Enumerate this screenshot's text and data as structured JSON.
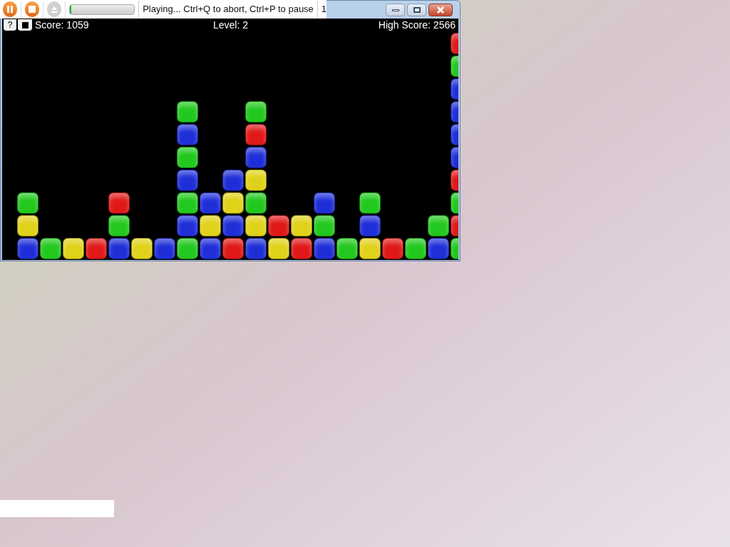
{
  "toolbar": {
    "pause": {
      "disabled": false
    },
    "stop": {
      "disabled": false
    },
    "eject": {
      "disabled": true
    },
    "progress": {
      "level": 0.02
    },
    "status": "Playing... Ctrl+Q to abort, Ctrl+P to pause",
    "counter": "1"
  },
  "window": {
    "buttons": [
      {
        "kind": "minimize"
      },
      {
        "kind": "maximize"
      },
      {
        "kind": "close"
      }
    ]
  },
  "hud": {
    "help": "?",
    "score": "Score: 1059",
    "level": "Level: 2",
    "high_score": "High Score: 2566"
  },
  "board": {
    "columns": [
      {
        "blocks": [
          {
            "color": "#1f2fd8"
          },
          {
            "color": "#e0d21a"
          },
          {
            "color": "#22c81e"
          }
        ]
      },
      {
        "blocks": [
          {
            "color": "#22c81e"
          }
        ]
      },
      {
        "blocks": [
          {
            "color": "#e0d21a"
          }
        ]
      },
      {
        "blocks": [
          {
            "color": "#e01818"
          }
        ]
      },
      {
        "blocks": [
          {
            "color": "#1f2fd8"
          },
          {
            "color": "#22c81e"
          },
          {
            "color": "#e01818"
          }
        ]
      },
      {
        "blocks": [
          {
            "color": "#e0d21a"
          }
        ]
      },
      {
        "blocks": [
          {
            "color": "#1f2fd8"
          }
        ]
      },
      {
        "blocks": [
          {
            "color": "#22c81e"
          },
          {
            "color": "#1f2fd8"
          },
          {
            "color": "#22c81e"
          },
          {
            "color": "#1f2fd8"
          },
          {
            "color": "#22c81e"
          },
          {
            "color": "#1f2fd8"
          },
          {
            "color": "#22c81e"
          }
        ]
      },
      {
        "blocks": [
          {
            "color": "#1f2fd8"
          },
          {
            "color": "#e0d21a"
          },
          {
            "color": "#1f2fd8"
          }
        ]
      },
      {
        "blocks": [
          {
            "color": "#e01818"
          },
          {
            "color": "#1f2fd8"
          },
          {
            "color": "#e0d21a"
          },
          {
            "color": "#1f2fd8"
          }
        ]
      },
      {
        "blocks": [
          {
            "color": "#1f2fd8"
          },
          {
            "color": "#e0d21a"
          },
          {
            "color": "#22c81e"
          },
          {
            "color": "#e0d21a"
          },
          {
            "color": "#1f2fd8"
          },
          {
            "color": "#e01818"
          },
          {
            "color": "#22c81e"
          }
        ]
      },
      {
        "blocks": [
          {
            "color": "#e0d21a"
          },
          {
            "color": "#e01818"
          }
        ]
      },
      {
        "blocks": [
          {
            "color": "#e01818"
          },
          {
            "color": "#e0d21a"
          }
        ]
      },
      {
        "blocks": [
          {
            "color": "#1f2fd8"
          },
          {
            "color": "#22c81e"
          },
          {
            "color": "#1f2fd8"
          }
        ]
      },
      {
        "blocks": [
          {
            "color": "#22c81e"
          }
        ]
      },
      {
        "blocks": [
          {
            "color": "#e0d21a"
          },
          {
            "color": "#1f2fd8"
          },
          {
            "color": "#22c81e"
          }
        ]
      },
      {
        "blocks": [
          {
            "color": "#e01818"
          }
        ]
      },
      {
        "blocks": [
          {
            "color": "#22c81e"
          }
        ]
      },
      {
        "blocks": [
          {
            "color": "#1f2fd8"
          },
          {
            "color": "#22c81e"
          }
        ]
      },
      {
        "blocks": [
          {
            "color": "#22c81e"
          },
          {
            "color": "#e01818"
          },
          {
            "color": "#22c81e"
          },
          {
            "color": "#e01818"
          },
          {
            "color": "#1f2fd8"
          },
          {
            "color": "#1f2fd8"
          },
          {
            "color": "#1f2fd8"
          },
          {
            "color": "#1f2fd8"
          },
          {
            "color": "#22c81e"
          },
          {
            "color": "#e01818"
          }
        ]
      }
    ]
  }
}
